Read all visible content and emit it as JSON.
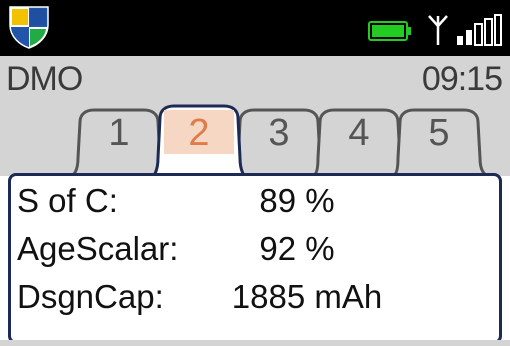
{
  "status_bar": {
    "logo_icon": "shield-logo-icon",
    "battery_icon": "battery-full-icon",
    "antenna_icon": "antenna-icon",
    "signal_icon": "signal-strength-icon",
    "battery_color": "#22cc22",
    "background": "#000000"
  },
  "header": {
    "device_name": "DMO",
    "time": "09:15"
  },
  "tabs": [
    {
      "label": "1",
      "active": false
    },
    {
      "label": "2",
      "active": true
    },
    {
      "label": "3",
      "active": false
    },
    {
      "label": "4",
      "active": false
    },
    {
      "label": "5",
      "active": false
    }
  ],
  "panel": {
    "rows": [
      {
        "label": "S of C:",
        "value": "89 %"
      },
      {
        "label": "AgeScalar:",
        "value": "92 %"
      },
      {
        "label": "DsgnCap:",
        "value": "1885 mAh"
      }
    ]
  },
  "colors": {
    "active_tab_fill": "#f5d7c3",
    "active_tab_text": "#e07b4a",
    "panel_border": "#1c2a55",
    "header_background": "#d4d4d4"
  }
}
